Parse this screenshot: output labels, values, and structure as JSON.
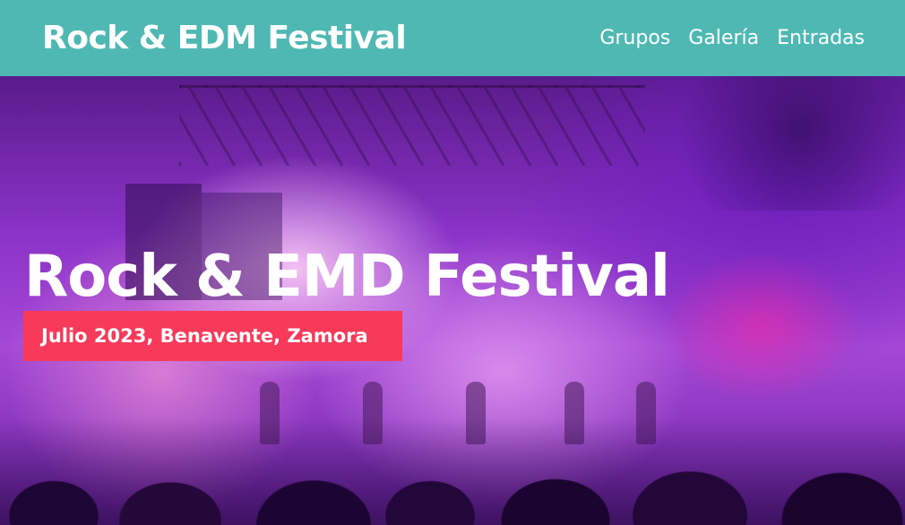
{
  "header": {
    "brand": "Rock & EDM Festival",
    "nav": [
      {
        "label": "Grupos"
      },
      {
        "label": "Galería"
      },
      {
        "label": "Entradas"
      }
    ]
  },
  "hero": {
    "title": "Rock & EMD Festival",
    "subtitle": "Julio 2023, Benavente, Zamora",
    "background": "concert-stage-photo"
  },
  "colors": {
    "header_bg": "#4fb8b3",
    "badge_bg": "#f73a5a",
    "text": "#ffffff"
  }
}
